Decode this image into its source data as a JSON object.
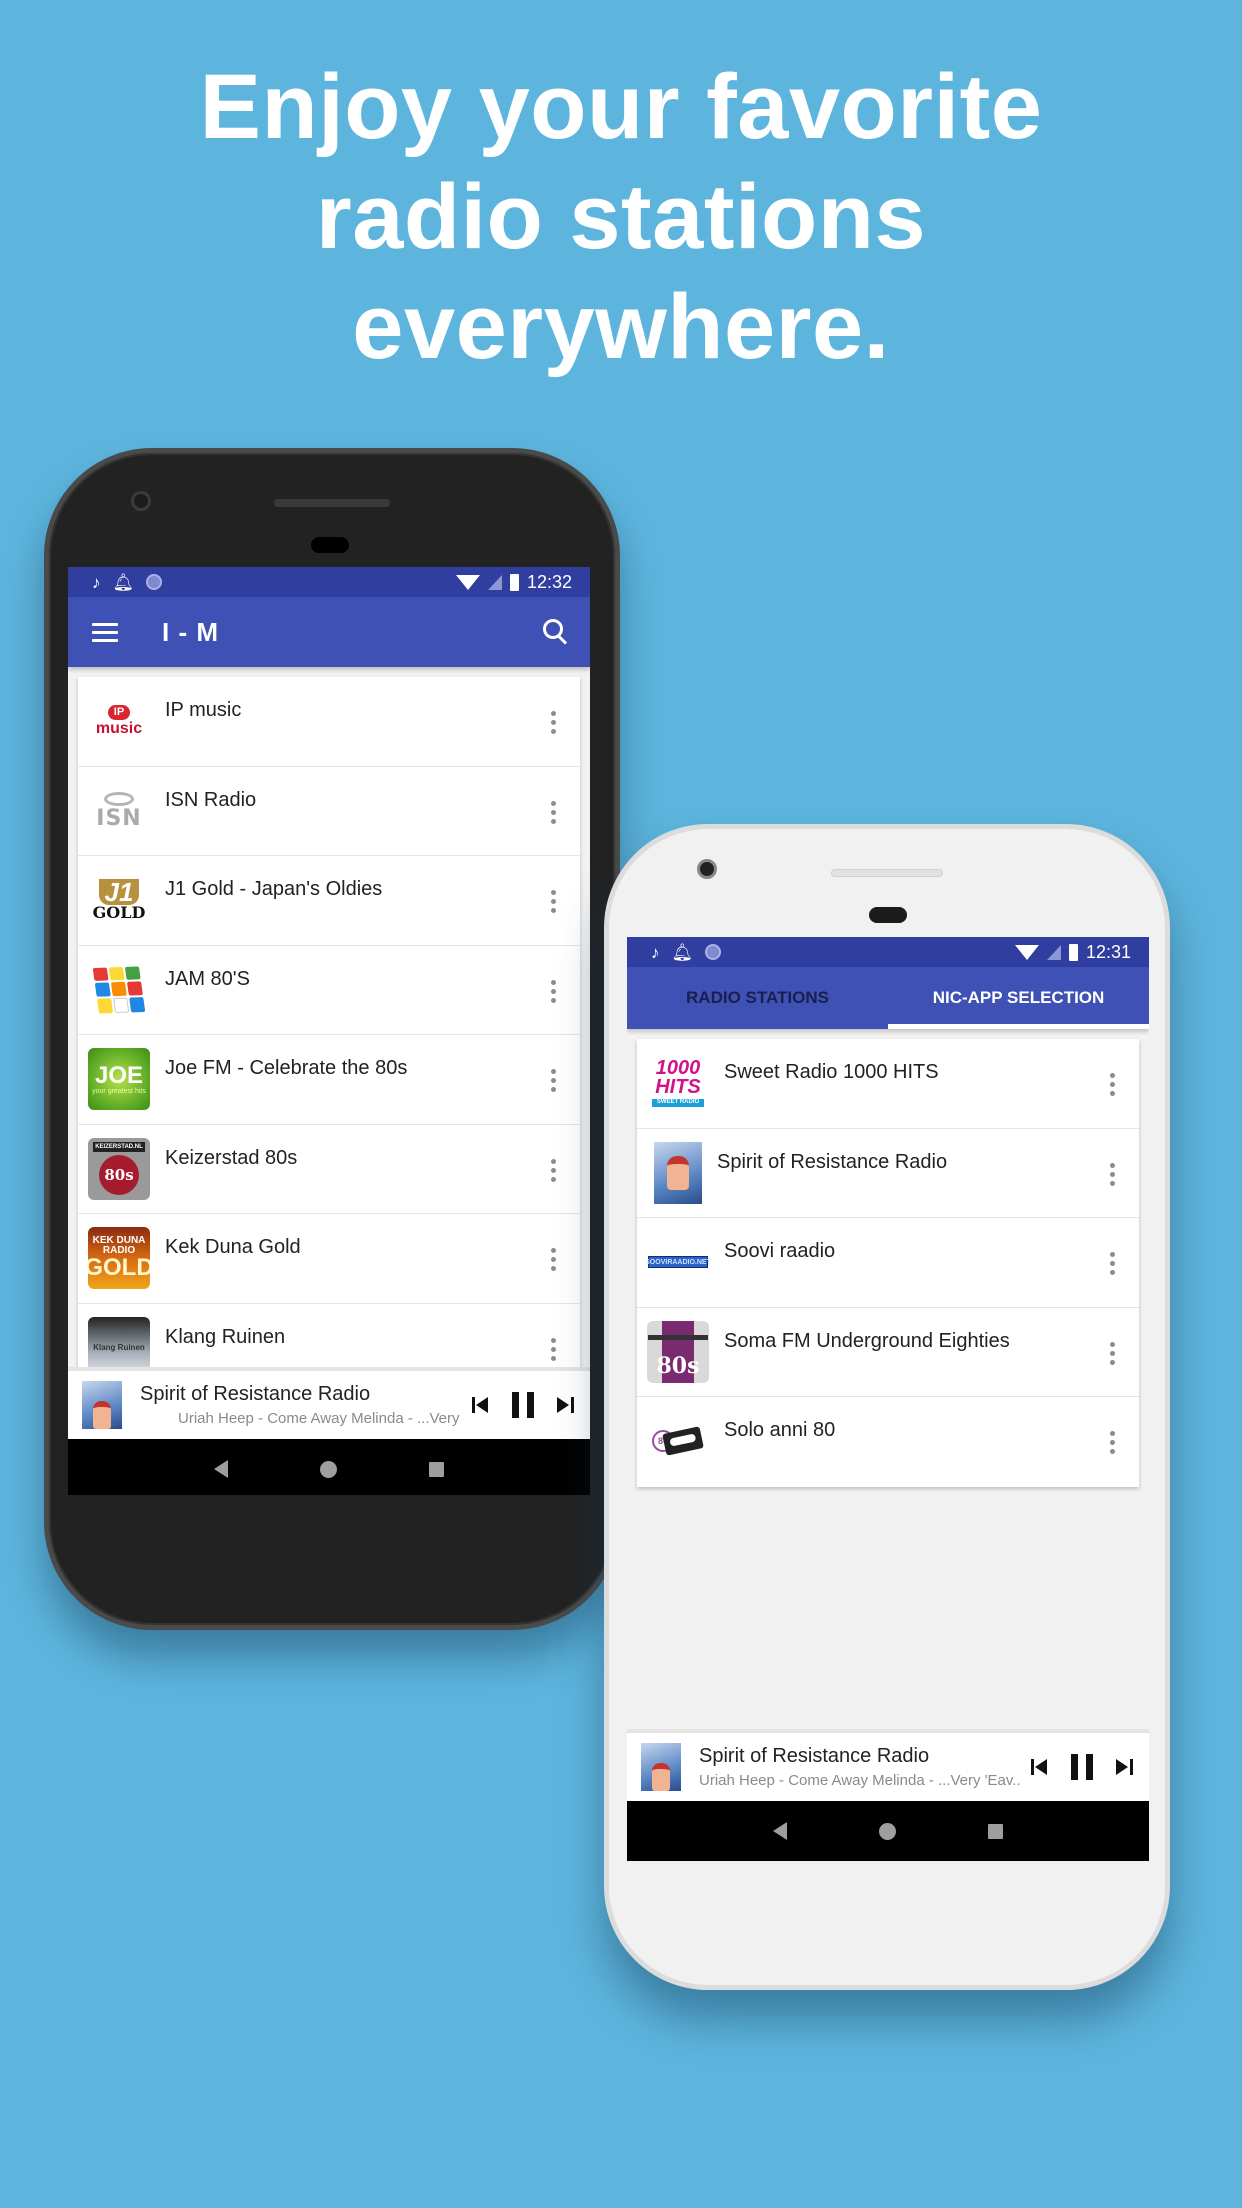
{
  "headline": {
    "lines": [
      "Enjoy your favorite",
      "radio stations",
      "everywhere."
    ]
  },
  "colors": {
    "background": "#5db5dd",
    "primary": "#3f51b5",
    "primary_dark": "#303f9f"
  },
  "phone_left": {
    "status_bar": {
      "time": "12:32",
      "left_icons": [
        "music-note-icon",
        "bell-icon",
        "circle-icon"
      ],
      "right_icons": [
        "wifi-icon",
        "signal-icon",
        "battery-icon"
      ]
    },
    "app_bar": {
      "title": "I - M",
      "menu_icon": "hamburger-icon",
      "search_icon": "search-icon"
    },
    "stations": [
      {
        "name": "IP music",
        "logo": "ip-music-logo",
        "logo_text": "music",
        "logo_badge": "IP"
      },
      {
        "name": "ISN Radio",
        "logo": "isn-radio-logo",
        "logo_text": "ISN"
      },
      {
        "name": "J1 Gold - Japan's Oldies",
        "logo": "j1-gold-logo",
        "logo_text": "J1",
        "logo_sub": "GOLD"
      },
      {
        "name": "JAM 80'S",
        "logo": "rubiks-cube-logo"
      },
      {
        "name": "Joe FM - Celebrate the 80s",
        "logo": "joe-fm-logo",
        "logo_text": "JOE",
        "logo_sub": "your greatest hits"
      },
      {
        "name": "Keizerstad 80s",
        "logo": "keizerstad-logo",
        "logo_text": "KEIZERSTAD.NL",
        "logo_sub": "80s"
      },
      {
        "name": "Kek Duna Gold",
        "logo": "kek-duna-logo",
        "logo_text": "KEK DUNA RADIO",
        "logo_sub": "GOLD"
      },
      {
        "name": "Klang Ruinen",
        "logo": "klang-ruinen-logo",
        "logo_text": "Klang Ruinen"
      }
    ],
    "player": {
      "title": "Spirit of Resistance Radio",
      "subtitle": "Uriah Heep - Come Away Melinda - ...Very",
      "controls": [
        "skip-previous",
        "pause",
        "skip-next"
      ]
    },
    "nav": [
      "back",
      "home",
      "recents"
    ]
  },
  "phone_right": {
    "status_bar": {
      "time": "12:31",
      "left_icons": [
        "music-note-icon",
        "bell-icon",
        "circle-icon"
      ],
      "right_icons": [
        "wifi-icon",
        "signal-icon",
        "battery-icon"
      ]
    },
    "tabs": [
      {
        "label": "RADIO STATIONS",
        "active": false
      },
      {
        "label": "NIC-APP SELECTION",
        "active": true
      }
    ],
    "stations": [
      {
        "name": "Sweet Radio 1000 HITS",
        "logo": "1000-hits-logo",
        "logo_text": "1000 HITS",
        "logo_sub": "SWEET RADIO"
      },
      {
        "name": "Spirit of Resistance Radio",
        "logo": "spirit-of-resistance-logo"
      },
      {
        "name": "Soovi raadio",
        "logo": "soovi-raadio-logo",
        "logo_text": "SOOVIRAADIO.NET"
      },
      {
        "name": "Soma FM Underground Eighties",
        "logo": "soma-fm-logo",
        "logo_text": "80s"
      },
      {
        "name": "Solo anni 80",
        "logo": "solo-anni-80-logo",
        "logo_text": "80"
      }
    ],
    "player": {
      "title": "Spirit of Resistance Radio",
      "subtitle": "Uriah Heep - Come Away Melinda - ...Very 'Eav..",
      "controls": [
        "skip-previous",
        "pause",
        "skip-next"
      ]
    },
    "nav": [
      "back",
      "home",
      "recents"
    ]
  }
}
